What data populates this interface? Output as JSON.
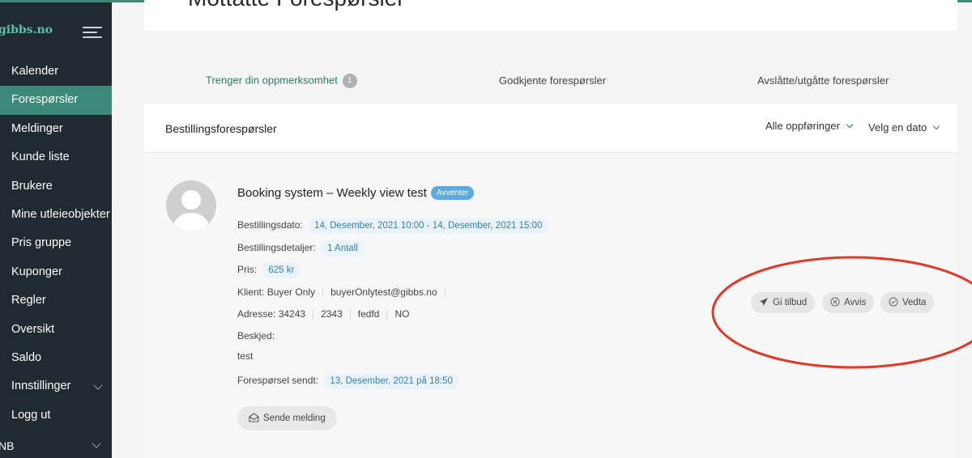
{
  "sidebar": {
    "logo": "gibbs.no",
    "items": [
      {
        "label": "Kalender"
      },
      {
        "label": "Forespørsler"
      },
      {
        "label": "Meldinger"
      },
      {
        "label": "Kunde liste"
      },
      {
        "label": "Brukere"
      },
      {
        "label": "Mine utleieobjekter"
      },
      {
        "label": "Pris gruppe"
      },
      {
        "label": "Kuponger"
      },
      {
        "label": "Regler"
      },
      {
        "label": "Oversikt"
      },
      {
        "label": "Saldo"
      },
      {
        "label": "Innstillinger"
      },
      {
        "label": "Logg ut"
      }
    ],
    "language": "NB"
  },
  "header": {
    "title": "Mottatte Forespørsler"
  },
  "tabs": [
    {
      "label": "Trenger din oppmerksomhet",
      "badge": "1"
    },
    {
      "label": "Godkjente forespørsler"
    },
    {
      "label": "Avslåtte/utgåtte forespørsler"
    }
  ],
  "card": {
    "title": "Bestillingsforespørsler",
    "filters": {
      "entries": "Alle oppføringer",
      "date": "Velg en dato"
    }
  },
  "request": {
    "title": "Booking system – Weekly view test",
    "status": "Avventer",
    "booking_date_label": "Bestillingsdato:",
    "booking_date_value": "14, Desember, 2021 10:00 - 14, Desember, 2021 15:00",
    "details_label": "Bestillingsdetaljer:",
    "details_value": "1 Antall",
    "price_label": "Pris:",
    "price_value": "625 kr",
    "client_label": "Klient:",
    "client_name": "Buyer Only",
    "client_email": "buyerOnlytest@gibbs.no",
    "address_label": "Adresse:",
    "address_parts": [
      "34243",
      "2343",
      "fedfd",
      "NO"
    ],
    "message_label": "Beskjed:",
    "message_value": "test",
    "sent_label": "Forespørsel sendt:",
    "sent_value": "13, Desember, 2021 på 18:50",
    "send_message_label": "Sende melding"
  },
  "actions": {
    "offer_label": "Gi tilbud",
    "reject_label": "Avvis",
    "accept_label": "Vedta"
  },
  "colors": {
    "brand": "#3d8a78",
    "sidebar_bg": "#1f2b30",
    "pill_bg": "#e9f3f9",
    "pill_text": "#3a7fb0",
    "status_badge": "#5ea9dd",
    "annotation": "#e03a2a"
  }
}
